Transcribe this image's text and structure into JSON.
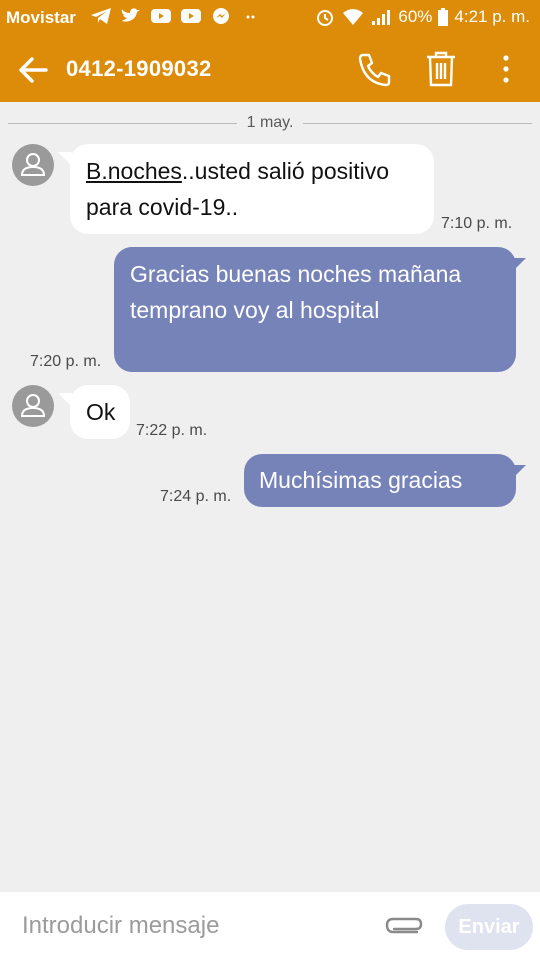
{
  "status_bar": {
    "carrier": "Movistar",
    "battery": "60%",
    "time": "4:21 p. m."
  },
  "header": {
    "title": "0412-1909032"
  },
  "conversation": {
    "date": "1 may.",
    "messages": [
      {
        "direction": "in",
        "link_text": "B.noches",
        "text": "..usted salió positivo para covid-19..",
        "time": "7:10 p. m."
      },
      {
        "direction": "out",
        "text": "Gracias buenas noches mañana temprano voy al hospital",
        "time": "7:20 p. m."
      },
      {
        "direction": "in",
        "text": "Ok",
        "time": "7:22 p. m."
      },
      {
        "direction": "out",
        "text": "Muchísimas gracias",
        "time": "7:24 p. m."
      }
    ]
  },
  "composer": {
    "placeholder": "Introducir mensaje",
    "send_label": "Enviar"
  },
  "colors": {
    "app_bar": "#dc8c08",
    "outgoing_bubble": "#7683b9",
    "incoming_bubble": "#ffffff",
    "background": "#efeff0"
  }
}
